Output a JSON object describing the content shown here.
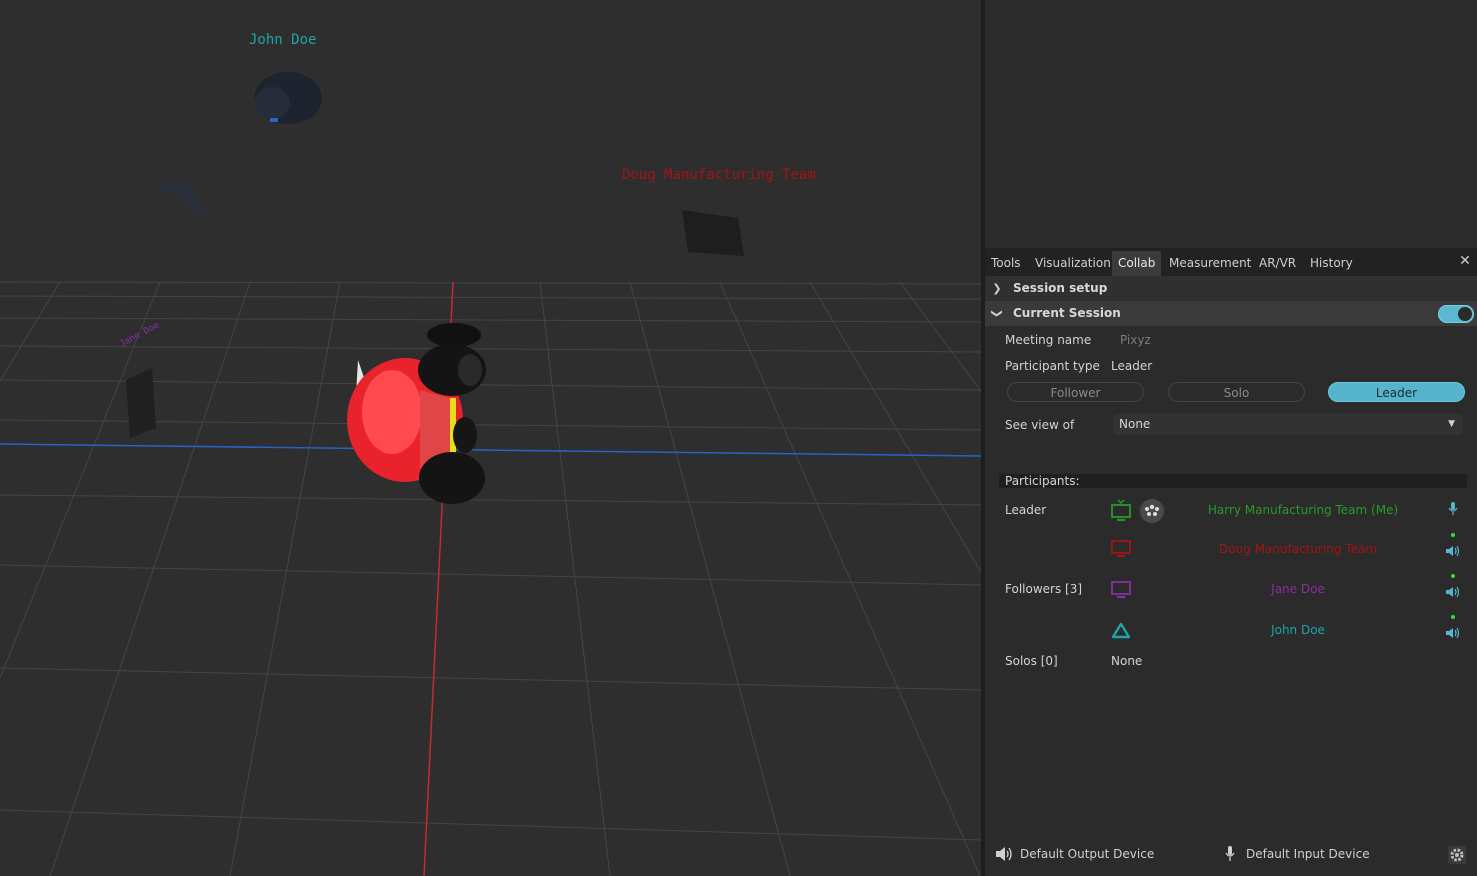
{
  "viewport": {
    "labels": {
      "john": "John Doe",
      "doug": "Doug Manufacturing Team",
      "jane": "Jane Doe"
    },
    "colors": {
      "john": "#1fa5a6",
      "doug": "#a31414",
      "jane": "#8b2fa0",
      "x_axis": "#c22c2c",
      "z_axis": "#2962c4",
      "car_body": "#e8232b"
    }
  },
  "tabs": [
    "Tools",
    "Visualization",
    "Collab",
    "Measurement",
    "AR/VR",
    "History"
  ],
  "active_tab": "Collab",
  "sections": {
    "setup": "Session setup",
    "current": "Current Session"
  },
  "session": {
    "meeting_label": "Meeting name",
    "meeting_placeholder": "Pixyz",
    "participant_type_label": "Participant type",
    "participant_type_value": "Leader",
    "roles": [
      "Follower",
      "Solo",
      "Leader"
    ],
    "selected_role": "Leader",
    "see_view_label": "See view of",
    "see_view_value": "None",
    "participants_title": "Participants:",
    "leader_label": "Leader",
    "followers_label": "Followers [3]",
    "solos_label": "Solos [0]",
    "solos_value": "None",
    "people": {
      "harry": "Harry Manufacturing Team (Me)",
      "doug": "Doug Manufacturing Team",
      "jane": "Jane Doe",
      "john": "John Doe"
    },
    "people_colors": {
      "harry": "#2a9a2a",
      "doug": "#a31414",
      "jane": "#8b2fa0",
      "john": "#1fa5a6"
    }
  },
  "footer": {
    "output_device": "Default Output Device",
    "input_device": "Default Input Device"
  },
  "accent": "#56b4cc"
}
